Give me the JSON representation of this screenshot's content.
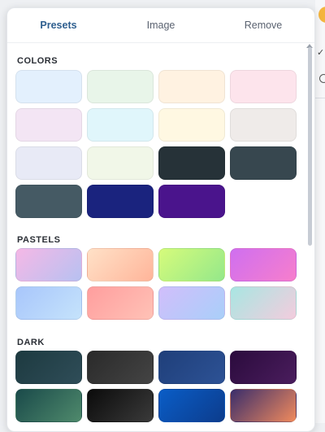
{
  "tabs": [
    {
      "label": "Presets",
      "active": true
    },
    {
      "label": "Image",
      "active": false
    },
    {
      "label": "Remove",
      "active": false
    }
  ],
  "sections": [
    {
      "title": "COLORS",
      "swatches": [
        {
          "name": "swatch-light-blue",
          "bg": "#e3f0fd"
        },
        {
          "name": "swatch-light-green",
          "bg": "#e8f5e9"
        },
        {
          "name": "swatch-light-peach",
          "bg": "#fff2e1"
        },
        {
          "name": "swatch-light-pink",
          "bg": "#fde4ec"
        },
        {
          "name": "swatch-light-lavender",
          "bg": "#f3e5f4"
        },
        {
          "name": "swatch-light-cyan",
          "bg": "#e0f6fb"
        },
        {
          "name": "swatch-light-cream",
          "bg": "#fff8e2"
        },
        {
          "name": "swatch-light-gray",
          "bg": "#efebe9"
        },
        {
          "name": "swatch-light-indigo",
          "bg": "#e8eaf6"
        },
        {
          "name": "swatch-light-lime",
          "bg": "#f1f7e8"
        },
        {
          "name": "swatch-charcoal",
          "bg": "#263238"
        },
        {
          "name": "swatch-dark-slate",
          "bg": "#37474f"
        },
        {
          "name": "swatch-slate",
          "bg": "#455a64"
        },
        {
          "name": "swatch-navy",
          "bg": "#1a237e"
        },
        {
          "name": "swatch-purple",
          "bg": "#4a148c"
        }
      ]
    },
    {
      "title": "PASTELS",
      "swatches": [
        {
          "name": "swatch-pink-lilac-gradient",
          "bg": "linear-gradient(135deg,#f5b8e6,#b7c1f1)"
        },
        {
          "name": "swatch-peach-gradient",
          "bg": "linear-gradient(135deg,#ffe1c7,#ffb59a)"
        },
        {
          "name": "swatch-lime-green-gradient",
          "bg": "linear-gradient(135deg,#d6fb7b,#94e88a)"
        },
        {
          "name": "swatch-violet-pink-gradient",
          "bg": "linear-gradient(135deg,#cf6ff0,#f77ecc)"
        },
        {
          "name": "swatch-sky-blue-gradient",
          "bg": "linear-gradient(135deg,#a8c6fb,#c5e3fb)"
        },
        {
          "name": "swatch-coral-gradient",
          "bg": "linear-gradient(135deg,#ff9e9e,#ffc2b6)"
        },
        {
          "name": "swatch-periwinkle-gradient",
          "bg": "linear-gradient(135deg,#d1befb,#a9cff9)"
        },
        {
          "name": "swatch-mint-rose-gradient",
          "bg": "linear-gradient(135deg,#a8e6e2,#f3ccdd)"
        }
      ]
    },
    {
      "title": "DARK",
      "swatches": [
        {
          "name": "swatch-deep-teal-dark",
          "bg": "linear-gradient(135deg,#1d3a40,#2f4d58)"
        },
        {
          "name": "swatch-graphite-dark",
          "bg": "linear-gradient(135deg,#2a2a2a,#444444)"
        },
        {
          "name": "swatch-navy-blue-dark",
          "bg": "linear-gradient(135deg,#1f3f7a,#2d5295)"
        },
        {
          "name": "swatch-plum-dark",
          "bg": "linear-gradient(135deg,#2b0b3d,#4a1d5d)"
        },
        {
          "name": "swatch-emerald-dark",
          "bg": "linear-gradient(135deg,#1a4a4a,#4f8a6c)"
        },
        {
          "name": "swatch-black-dark",
          "bg": "linear-gradient(135deg,#0b0b0b,#3a3a3a)"
        },
        {
          "name": "swatch-royal-blue-dark",
          "bg": "linear-gradient(135deg,#0a5dc7,#0c3c8c)"
        },
        {
          "name": "swatch-sunset-dark",
          "bg": "linear-gradient(135deg,#3a2d6b,#f08a5d)"
        }
      ]
    }
  ]
}
